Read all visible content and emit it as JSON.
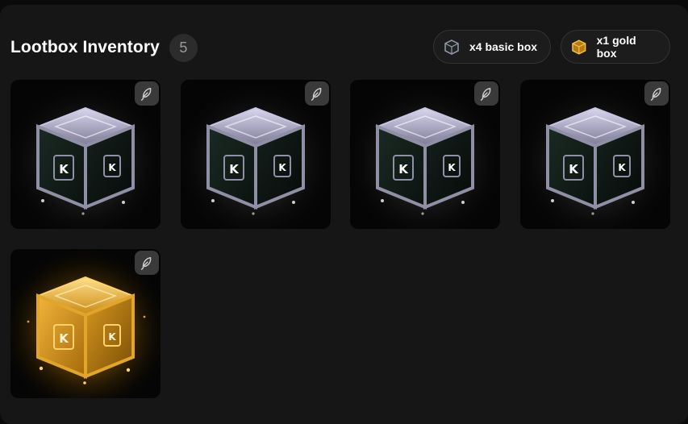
{
  "header": {
    "title": "Lootbox Inventory",
    "count": "5"
  },
  "summary_chips": [
    {
      "label": "x4 basic box",
      "icon": "basic-box-icon"
    },
    {
      "label": "x1 gold box",
      "icon": "gold-box-icon"
    }
  ],
  "colors": {
    "panel_bg": "#161616",
    "page_bg": "#0a0a0a",
    "basic_box_frame": "#8f8fa6",
    "basic_box_face": "#17201c",
    "basic_box_glow": "#ffffff",
    "gold_box_frame": "#e0a52a",
    "gold_box_glow": "#f5b820"
  },
  "inventory": [
    {
      "type": "basic",
      "logo": "K",
      "action_icon": "feather-icon"
    },
    {
      "type": "basic",
      "logo": "K",
      "action_icon": "feather-icon"
    },
    {
      "type": "basic",
      "logo": "K",
      "action_icon": "feather-icon"
    },
    {
      "type": "basic",
      "logo": "K",
      "action_icon": "feather-icon"
    },
    {
      "type": "gold",
      "logo": "K",
      "action_icon": "feather-icon"
    }
  ]
}
